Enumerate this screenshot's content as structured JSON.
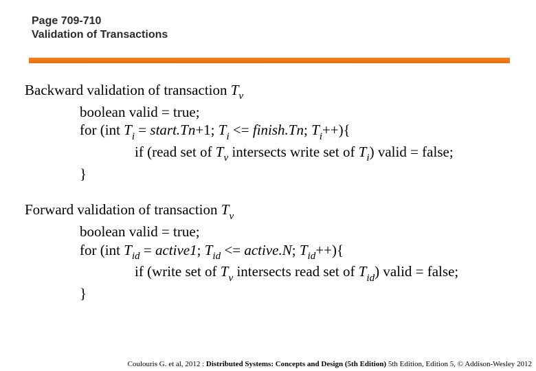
{
  "header": {
    "line1": "Page 709-710",
    "line2": "Validation of Transactions"
  },
  "backward": {
    "title_prefix": "Backward validation of transaction ",
    "tv": "T",
    "tv_sub": "v",
    "l1": "boolean valid = true;",
    "l2_a": "for (int ",
    "l2_ti": "T",
    "l2_ti_sub": "i",
    "l2_b": "  = ",
    "l2_start": "start.Tn",
    "l2_c": "+1; ",
    "l2_ti2": "T",
    "l2_ti2_sub": "i",
    "l2_d": " <= ",
    "l2_finish": "finish.Tn",
    "l2_e": "; ",
    "l2_ti3": "T",
    "l2_ti3_sub": "i",
    "l2_f": "++){",
    "l3_a": "if (read set of ",
    "l3_tv": "T",
    "l3_tv_sub": "v",
    "l3_b": " intersects write set of ",
    "l3_ti": "T",
    "l3_ti_sub": "i",
    "l3_c": ") valid = false;",
    "l4": "}"
  },
  "forward": {
    "title_prefix": "Forward validation of transaction ",
    "tv": "T",
    "tv_sub": "v",
    "l1": "boolean valid = true;",
    "l2_a": "for (int ",
    "l2_tid": "T",
    "l2_tid_sub": "id",
    "l2_b": " = ",
    "l2_active1": "active1",
    "l2_c": "; ",
    "l2_tid2": "T",
    "l2_tid2_sub": "id",
    "l2_d": " <= ",
    "l2_activeN": "active.N",
    "l2_e": "; ",
    "l2_tid3": "T",
    "l2_tid3_sub": "id",
    "l2_f": "++){",
    "l3_a": "if (write set of ",
    "l3_tv": "T",
    "l3_tv_sub": "v",
    "l3_b": " intersects read set of ",
    "l3_tid": "T",
    "l3_tid_sub": "id",
    "l3_c": ") valid = false;",
    "l4": "}"
  },
  "footer": {
    "pre": "Coulouris G. et al, 2012 : ",
    "bold": "Distributed Systems: Concepts and Design (5th Edition) ",
    "post": "5th Edition, Edition 5, © Addison-Wesley 2012"
  }
}
